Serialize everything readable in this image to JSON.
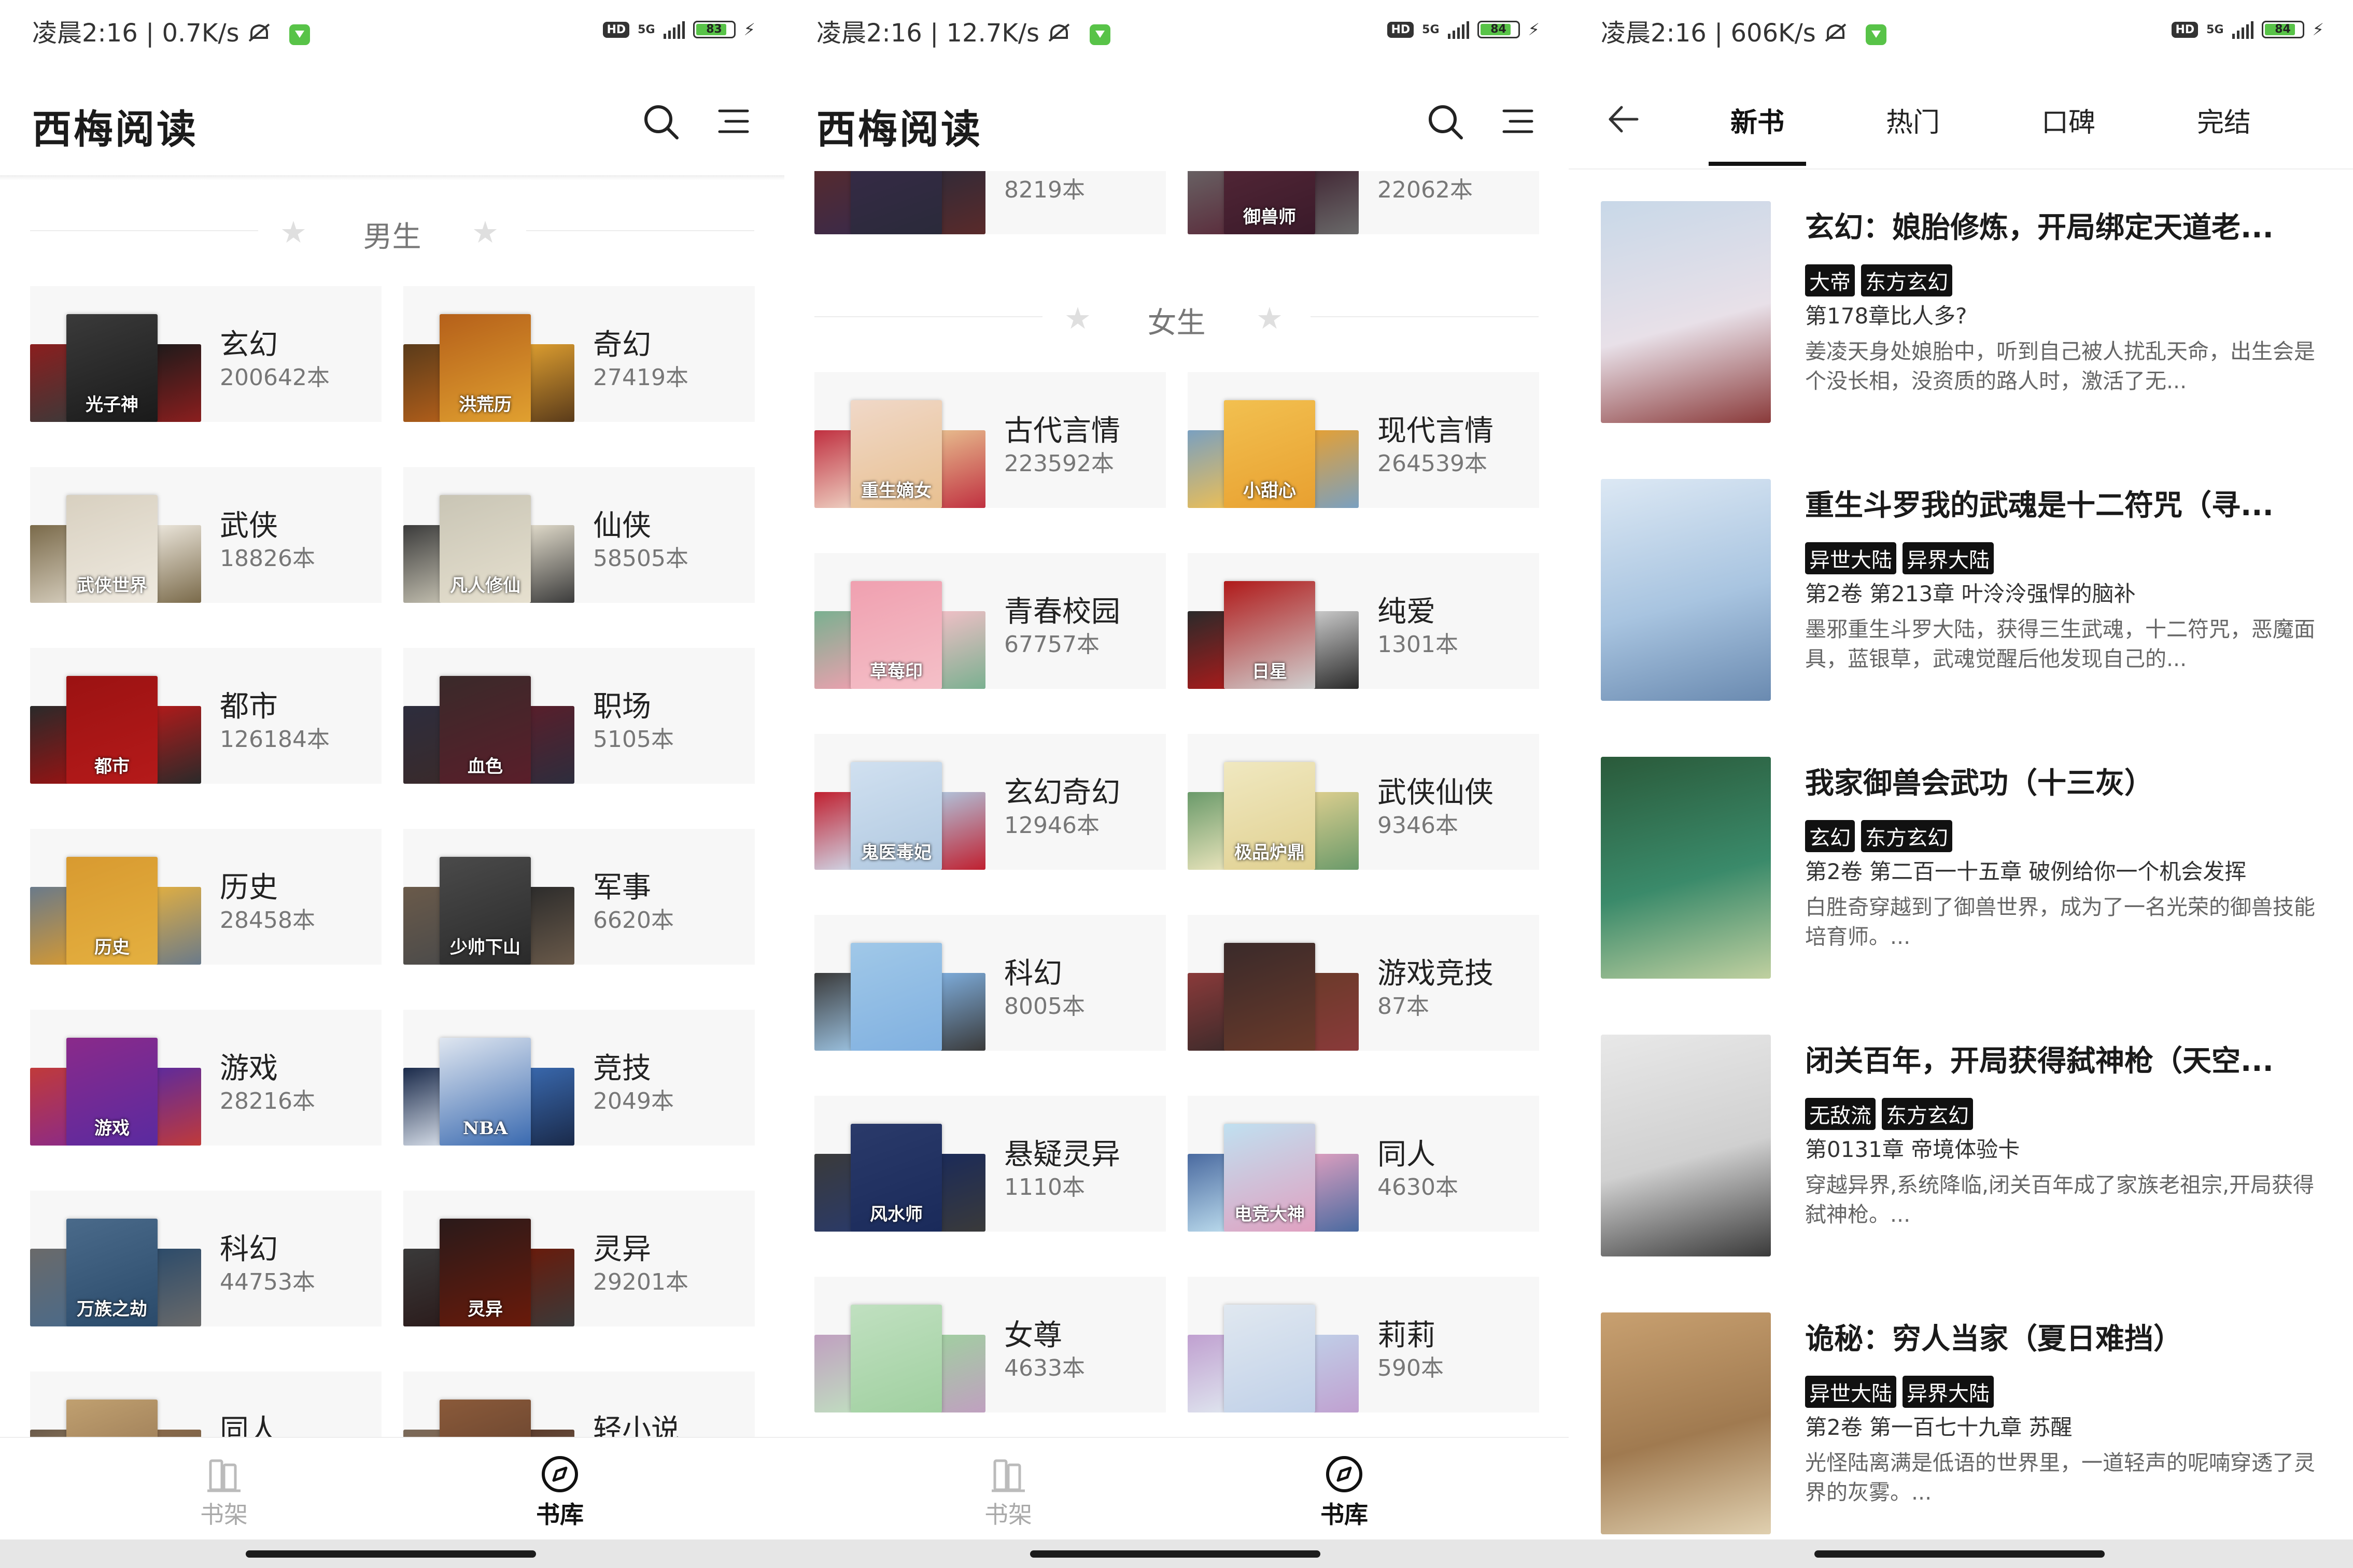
{
  "status_bars": [
    {
      "time": "凌晨2:16",
      "speed": "0.7K/s",
      "battery": "83",
      "battery_frac": 0.83
    },
    {
      "time": "凌晨2:16",
      "speed": "12.7K/s",
      "battery": "84",
      "battery_frac": 0.84
    },
    {
      "time": "凌晨2:16",
      "speed": "606K/s",
      "battery": "84",
      "battery_frac": 0.84
    }
  ],
  "status_labels": {
    "hd": "HD",
    "network": "5G"
  },
  "app": {
    "title": "西梅阅读"
  },
  "library1": {
    "section_male": "男生",
    "categories": [
      {
        "name": "玄幻",
        "count": "200642本",
        "cover_text": "光子神",
        "colors": [
          "#3a3a3a",
          "#1a1a1a",
          "#8b1e1e"
        ]
      },
      {
        "name": "奇幻",
        "count": "27419本",
        "cover_text": "洪荒历",
        "colors": [
          "#b5601a",
          "#e0a030",
          "#5a3b1a"
        ]
      },
      {
        "name": "武侠",
        "count": "18826本",
        "cover_text": "武侠世界",
        "colors": [
          "#d8d0c0",
          "#efeae0",
          "#7a6a4a"
        ]
      },
      {
        "name": "仙侠",
        "count": "58505本",
        "cover_text": "凡人修仙",
        "colors": [
          "#c9c5b5",
          "#e6e0cf",
          "#3b3b3b"
        ]
      },
      {
        "name": "都市",
        "count": "126184本",
        "cover_text": "都市",
        "colors": [
          "#9b1212",
          "#b51a1a",
          "#2a2a2a"
        ]
      },
      {
        "name": "职场",
        "count": "5105本",
        "cover_text": "血色",
        "colors": [
          "#3a2a2a",
          "#5a1e2a",
          "#2d2d3d"
        ]
      },
      {
        "name": "历史",
        "count": "28458本",
        "cover_text": "历史",
        "colors": [
          "#d89a30",
          "#e4b040",
          "#6a7a8a"
        ]
      },
      {
        "name": "军事",
        "count": "6620本",
        "cover_text": "少帅下山",
        "colors": [
          "#4a4a4a",
          "#2a2a2a",
          "#6a5a4a"
        ]
      },
      {
        "name": "游戏",
        "count": "28216本",
        "cover_text": "游戏",
        "colors": [
          "#8a2a8a",
          "#5a2aa0",
          "#c03a3a"
        ]
      },
      {
        "name": "竞技",
        "count": "2049本",
        "cover_text": "NBA",
        "colors": [
          "#dfe6f0",
          "#3a6ab0",
          "#1a2a4a"
        ]
      },
      {
        "name": "科幻",
        "count": "44753本",
        "cover_text": "万族之劫",
        "colors": [
          "#4a6a8a",
          "#2a4a6a",
          "#6a6a6a"
        ]
      },
      {
        "name": "灵异",
        "count": "29201本",
        "cover_text": "灵异",
        "colors": [
          "#2a1a1a",
          "#6a1a0a",
          "#3a3a3a"
        ]
      },
      {
        "name": "同人",
        "count": "",
        "cover_text": "",
        "colors": [
          "#c0a070",
          "#8a6a4a",
          "#6a5a4a"
        ]
      },
      {
        "name": "轻小说",
        "count": "",
        "cover_text": "",
        "colors": [
          "#8a5a3a",
          "#5a3a2a",
          "#7a6a5a"
        ]
      }
    ]
  },
  "library2": {
    "partial_top": [
      {
        "count": "8219本",
        "cover_text": "",
        "colors": [
          "#3a2a4a",
          "#2a2a3a",
          "#5a2a2a"
        ]
      },
      {
        "count": "22062本",
        "cover_text": "御兽师",
        "colors": [
          "#5a2a3a",
          "#3a1a2a",
          "#6a6a6a"
        ]
      }
    ],
    "section_female": "女生",
    "categories": [
      {
        "name": "古代言情",
        "count": "223592本",
        "cover_text": "重生嫡女",
        "colors": [
          "#f0d8c8",
          "#e8c090",
          "#c03040"
        ]
      },
      {
        "name": "现代言情",
        "count": "264539本",
        "cover_text": "小甜心",
        "colors": [
          "#f2c050",
          "#e8a030",
          "#7aa0c0"
        ]
      },
      {
        "name": "青春校园",
        "count": "67757本",
        "cover_text": "草莓印",
        "colors": [
          "#f0a0b0",
          "#f4c0c8",
          "#7ab090"
        ]
      },
      {
        "name": "纯爱",
        "count": "1301本",
        "cover_text": "日星",
        "colors": [
          "#b01a1a",
          "#d0d0d0",
          "#2a2a2a"
        ]
      },
      {
        "name": "玄幻奇幻",
        "count": "12946本",
        "cover_text": "鬼医毒妃",
        "colors": [
          "#d0e0f0",
          "#b0c8e0",
          "#c02030"
        ]
      },
      {
        "name": "武侠仙侠",
        "count": "9346本",
        "cover_text": "极品炉鼎",
        "colors": [
          "#f0e8c0",
          "#e0d090",
          "#6a9a6a"
        ]
      },
      {
        "name": "科幻",
        "count": "8005本",
        "cover_text": "",
        "colors": [
          "#a0c8e8",
          "#80b0e0",
          "#3a3a3a"
        ]
      },
      {
        "name": "游戏竞技",
        "count": "87本",
        "cover_text": "",
        "colors": [
          "#3a2a2a",
          "#6a3a2a",
          "#8a3a3a"
        ]
      },
      {
        "name": "悬疑灵异",
        "count": "1110本",
        "cover_text": "风水师",
        "colors": [
          "#2a3a6a",
          "#1a2a5a",
          "#3a3a3a"
        ]
      },
      {
        "name": "同人",
        "count": "4630本",
        "cover_text": "电竞大神",
        "colors": [
          "#c0e0f0",
          "#e0a0c0",
          "#4a6aa0"
        ]
      },
      {
        "name": "女尊",
        "count": "4633本",
        "cover_text": "",
        "colors": [
          "#c0e0c0",
          "#a0d0a0",
          "#c0a0c0"
        ]
      },
      {
        "name": "莉莉",
        "count": "590本",
        "cover_text": "",
        "colors": [
          "#e0e8f0",
          "#c0d0e8",
          "#c0a0d0"
        ]
      }
    ]
  },
  "nav": {
    "shelf": "书架",
    "store": "书库"
  },
  "tabs": [
    "新书",
    "热门",
    "口碑",
    "完结"
  ],
  "books": [
    {
      "title": "玄幻：娘胎修炼，开局绑定天道老...",
      "tags": [
        "大帝",
        "东方玄幻"
      ],
      "chapter": "第178章比人多?",
      "desc": "姜凌天身处娘胎中，听到自己被人扰乱天命，出生会是个没长相，没资质的路人时，激活了无...",
      "cover_text": "",
      "cover_colors": [
        "#c8d8e8",
        "#e8e0e8",
        "#8a3a3a"
      ]
    },
    {
      "title": "重生斗罗我的武魂是十二符咒（寻...",
      "tags": [
        "异世大陆",
        "异界大陆"
      ],
      "chapter": "第2卷  第213章 叶泠泠强悍的脑补",
      "desc": "墨邪重生斗罗大陆，获得三生武魂，十二符咒，恶魔面具，蓝银草，武魂觉醒后他发现自己的...",
      "cover_text": "",
      "cover_colors": [
        "#dce8f4",
        "#a8c4e0",
        "#6a8ab0"
      ]
    },
    {
      "title": "我家御兽会武功（十三灰）",
      "tags": [
        "玄幻",
        "东方玄幻"
      ],
      "chapter": "第2卷  第二百一十五章 破例给你一个机会发挥",
      "desc": "白胜奇穿越到了御兽世界，成为了一名光荣的御兽技能培育师。...",
      "cover_text": "",
      "cover_colors": [
        "#2a5a3a",
        "#3a8a6a",
        "#c0d0a0"
      ]
    },
    {
      "title": "闭关百年，开局获得弑神枪（天空...",
      "tags": [
        "无敌流",
        "东方玄幻"
      ],
      "chapter": "第0131章  帝境体验卡",
      "desc": "穿越异界,系统降临,闭关百年成了家族老祖宗,开局获得弑神枪。...",
      "cover_text": "",
      "cover_colors": [
        "#e8e8e8",
        "#d0d0d0",
        "#3a3a3a"
      ]
    },
    {
      "title": "诡秘：穷人当家（夏日难挡）",
      "tags": [
        "异世大陆",
        "异界大陆"
      ],
      "chapter": "第2卷  第一百七十九章 苏醒",
      "desc": "光怪陆离满是低语的世界里，一道轻声的呢喃穿透了灵界的灰雾。...",
      "cover_text": "",
      "cover_colors": [
        "#c8a070",
        "#a07a50",
        "#e0d0b0"
      ]
    }
  ],
  "icons": {
    "search": "search-icon",
    "menu": "menu-icon",
    "back": "back-arrow-icon",
    "shelf": "bookshelf-icon",
    "store": "compass-icon"
  }
}
